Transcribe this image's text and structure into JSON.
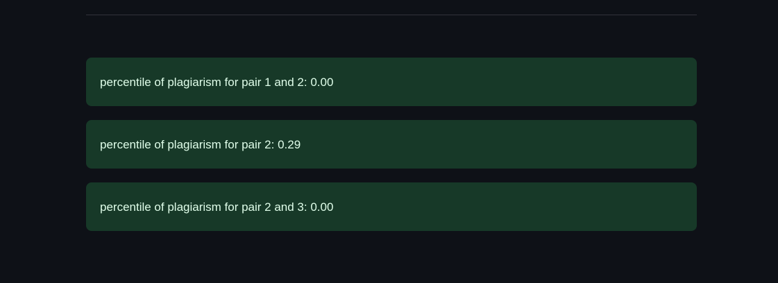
{
  "colors": {
    "background": "#0e1117",
    "divider": "#31333b",
    "success_bg": "#173928",
    "success_text": "#dffde9"
  },
  "alerts": [
    {
      "text": "percentile of plagiarism for pair 1 and 2: 0.00"
    },
    {
      "text": "percentile of plagiarism for pair 2: 0.29"
    },
    {
      "text": "percentile of plagiarism for pair 2 and 3: 0.00"
    }
  ]
}
